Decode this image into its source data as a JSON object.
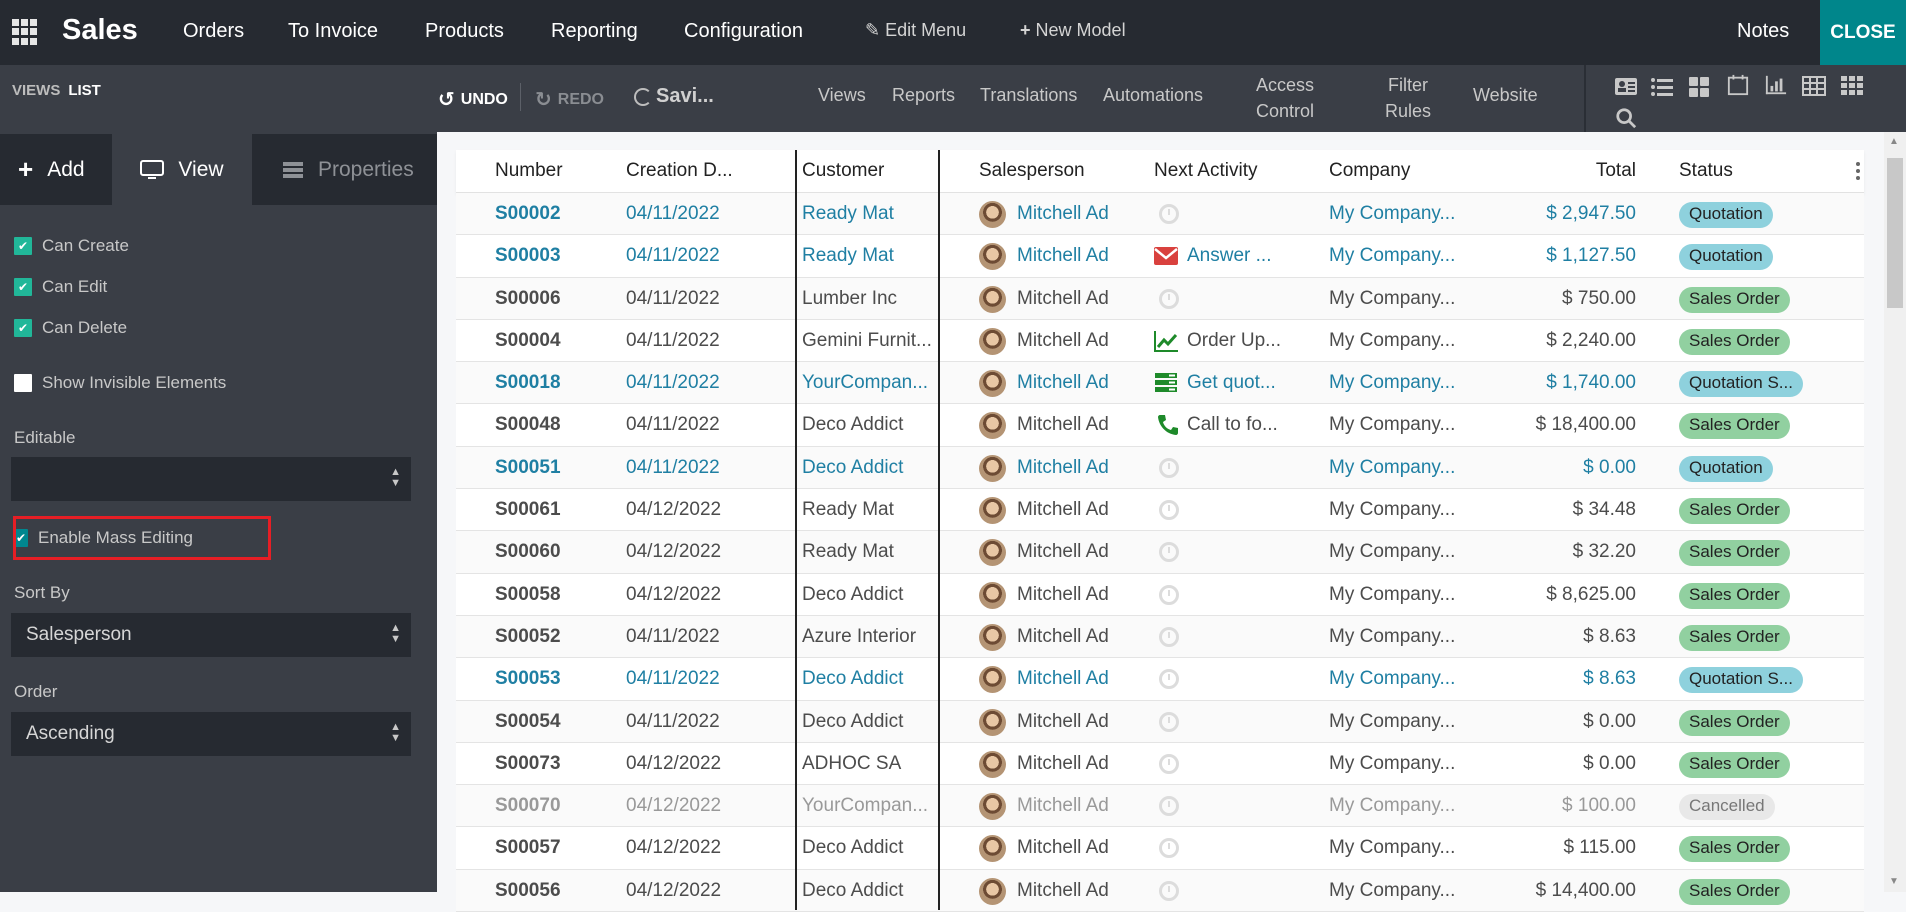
{
  "topnav": {
    "app_name": "Sales",
    "menus": [
      "Orders",
      "To Invoice",
      "Products",
      "Reporting",
      "Configuration"
    ],
    "edit_menu": "Edit Menu",
    "new_model": "New Model",
    "notes": "Notes",
    "close": "CLOSE"
  },
  "subbar": {
    "breadcrumb_root": "VIEWS",
    "breadcrumb_current": "LIST",
    "undo": "UNDO",
    "redo": "REDO",
    "saving": "Savi...",
    "nav": [
      "Views",
      "Reports",
      "Translations",
      "Automations"
    ],
    "access_control": [
      "Access",
      "Control"
    ],
    "filter_rules": [
      "Filter",
      "Rules"
    ],
    "website": "Website",
    "view_icons": [
      "form-view-icon",
      "list-view-icon",
      "kanban-view-icon",
      "calendar-view-icon",
      "graph-view-icon",
      "pivot-view-icon",
      "grid-view-icon",
      "search-view-icon"
    ]
  },
  "panel": {
    "tabs": {
      "add": "Add",
      "view": "View",
      "properties": "Properties"
    },
    "checkboxes": [
      {
        "label": "Can Create",
        "checked": true
      },
      {
        "label": "Can Edit",
        "checked": true
      },
      {
        "label": "Can Delete",
        "checked": true
      },
      {
        "label": "Show Invisible Elements",
        "checked": false
      }
    ],
    "editable_label": "Editable",
    "editable_value": "",
    "mass_editing_label": "Enable Mass Editing",
    "mass_editing_checked": true,
    "sort_by_label": "Sort By",
    "sort_by_value": "Salesperson",
    "order_label": "Order",
    "order_value": "Ascending"
  },
  "table": {
    "columns": [
      "Number",
      "Creation D...",
      "Customer",
      "Salesperson",
      "Next Activity",
      "Company",
      "Total",
      "Status"
    ],
    "rows": [
      {
        "number": "S00002",
        "date": "04/11/2022",
        "customer": "Ready Mat",
        "salesperson": "Mitchell Ad",
        "activity_icon": "clock",
        "activity": "",
        "company": "My Company...",
        "total": "$ 2,947.50",
        "status": "Quotation",
        "style": "link"
      },
      {
        "number": "S00003",
        "date": "04/11/2022",
        "customer": "Ready Mat",
        "salesperson": "Mitchell Ad",
        "activity_icon": "email",
        "activity": "Answer ...",
        "company": "My Company...",
        "total": "$ 1,127.50",
        "status": "Quotation",
        "style": "link"
      },
      {
        "number": "S00006",
        "date": "04/11/2022",
        "customer": "Lumber Inc",
        "salesperson": "Mitchell Ad",
        "activity_icon": "clock",
        "activity": "",
        "company": "My Company...",
        "total": "$ 750.00",
        "status": "Sales Order",
        "style": "normal"
      },
      {
        "number": "S00004",
        "date": "04/11/2022",
        "customer": "Gemini Furnit...",
        "salesperson": "Mitchell Ad",
        "activity_icon": "chart",
        "activity": "Order Up...",
        "company": "My Company...",
        "total": "$ 2,240.00",
        "status": "Sales Order",
        "style": "normal"
      },
      {
        "number": "S00018",
        "date": "04/11/2022",
        "customer": "YourCompan...",
        "salesperson": "Mitchell Ad",
        "activity_icon": "tasks",
        "activity": "Get quot...",
        "company": "My Company...",
        "total": "$ 1,740.00",
        "status": "Quotation S...",
        "style": "link"
      },
      {
        "number": "S00048",
        "date": "04/11/2022",
        "customer": "Deco Addict",
        "salesperson": "Mitchell Ad",
        "activity_icon": "phone",
        "activity": "Call to fo...",
        "company": "My Company...",
        "total": "$ 18,400.00",
        "status": "Sales Order",
        "style": "normal"
      },
      {
        "number": "S00051",
        "date": "04/11/2022",
        "customer": "Deco Addict",
        "salesperson": "Mitchell Ad",
        "activity_icon": "clock",
        "activity": "",
        "company": "My Company...",
        "total": "$ 0.00",
        "status": "Quotation",
        "style": "link"
      },
      {
        "number": "S00061",
        "date": "04/12/2022",
        "customer": "Ready Mat",
        "salesperson": "Mitchell Ad",
        "activity_icon": "clock",
        "activity": "",
        "company": "My Company...",
        "total": "$ 34.48",
        "status": "Sales Order",
        "style": "normal"
      },
      {
        "number": "S00060",
        "date": "04/12/2022",
        "customer": "Ready Mat",
        "salesperson": "Mitchell Ad",
        "activity_icon": "clock",
        "activity": "",
        "company": "My Company...",
        "total": "$ 32.20",
        "status": "Sales Order",
        "style": "normal"
      },
      {
        "number": "S00058",
        "date": "04/12/2022",
        "customer": "Deco Addict",
        "salesperson": "Mitchell Ad",
        "activity_icon": "clock",
        "activity": "",
        "company": "My Company...",
        "total": "$ 8,625.00",
        "status": "Sales Order",
        "style": "normal"
      },
      {
        "number": "S00052",
        "date": "04/11/2022",
        "customer": "Azure Interior",
        "salesperson": "Mitchell Ad",
        "activity_icon": "clock",
        "activity": "",
        "company": "My Company...",
        "total": "$ 8.63",
        "status": "Sales Order",
        "style": "normal"
      },
      {
        "number": "S00053",
        "date": "04/11/2022",
        "customer": "Deco Addict",
        "salesperson": "Mitchell Ad",
        "activity_icon": "clock",
        "activity": "",
        "company": "My Company...",
        "total": "$ 8.63",
        "status": "Quotation S...",
        "style": "link"
      },
      {
        "number": "S00054",
        "date": "04/11/2022",
        "customer": "Deco Addict",
        "salesperson": "Mitchell Ad",
        "activity_icon": "clock",
        "activity": "",
        "company": "My Company...",
        "total": "$ 0.00",
        "status": "Sales Order",
        "style": "normal"
      },
      {
        "number": "S00073",
        "date": "04/12/2022",
        "customer": "ADHOC SA",
        "salesperson": "Mitchell Ad",
        "activity_icon": "clock",
        "activity": "",
        "company": "My Company...",
        "total": "$ 0.00",
        "status": "Sales Order",
        "style": "normal"
      },
      {
        "number": "S00070",
        "date": "04/12/2022",
        "customer": "YourCompan...",
        "salesperson": "Mitchell Ad",
        "activity_icon": "clock",
        "activity": "",
        "company": "My Company...",
        "total": "$ 100.00",
        "status": "Cancelled",
        "style": "muted"
      },
      {
        "number": "S00057",
        "date": "04/12/2022",
        "customer": "Deco Addict",
        "salesperson": "Mitchell Ad",
        "activity_icon": "clock",
        "activity": "",
        "company": "My Company...",
        "total": "$ 115.00",
        "status": "Sales Order",
        "style": "normal"
      },
      {
        "number": "S00056",
        "date": "04/12/2022",
        "customer": "Deco Addict",
        "salesperson": "Mitchell Ad",
        "activity_icon": "clock",
        "activity": "",
        "company": "My Company...",
        "total": "$ 14,400.00",
        "status": "Sales Order",
        "style": "normal"
      }
    ]
  },
  "colors": {
    "topnav_bg": "#262a31",
    "panel_bg": "#3a3e46",
    "close_bg": "#00868b",
    "link": "#1f7fa3",
    "checkbox": "#21b799",
    "highlight": "#e61e25",
    "badge_quotation": "#8ed1dd",
    "badge_sales_order": "#91d0a0",
    "badge_cancelled": "#e8e8e8"
  }
}
